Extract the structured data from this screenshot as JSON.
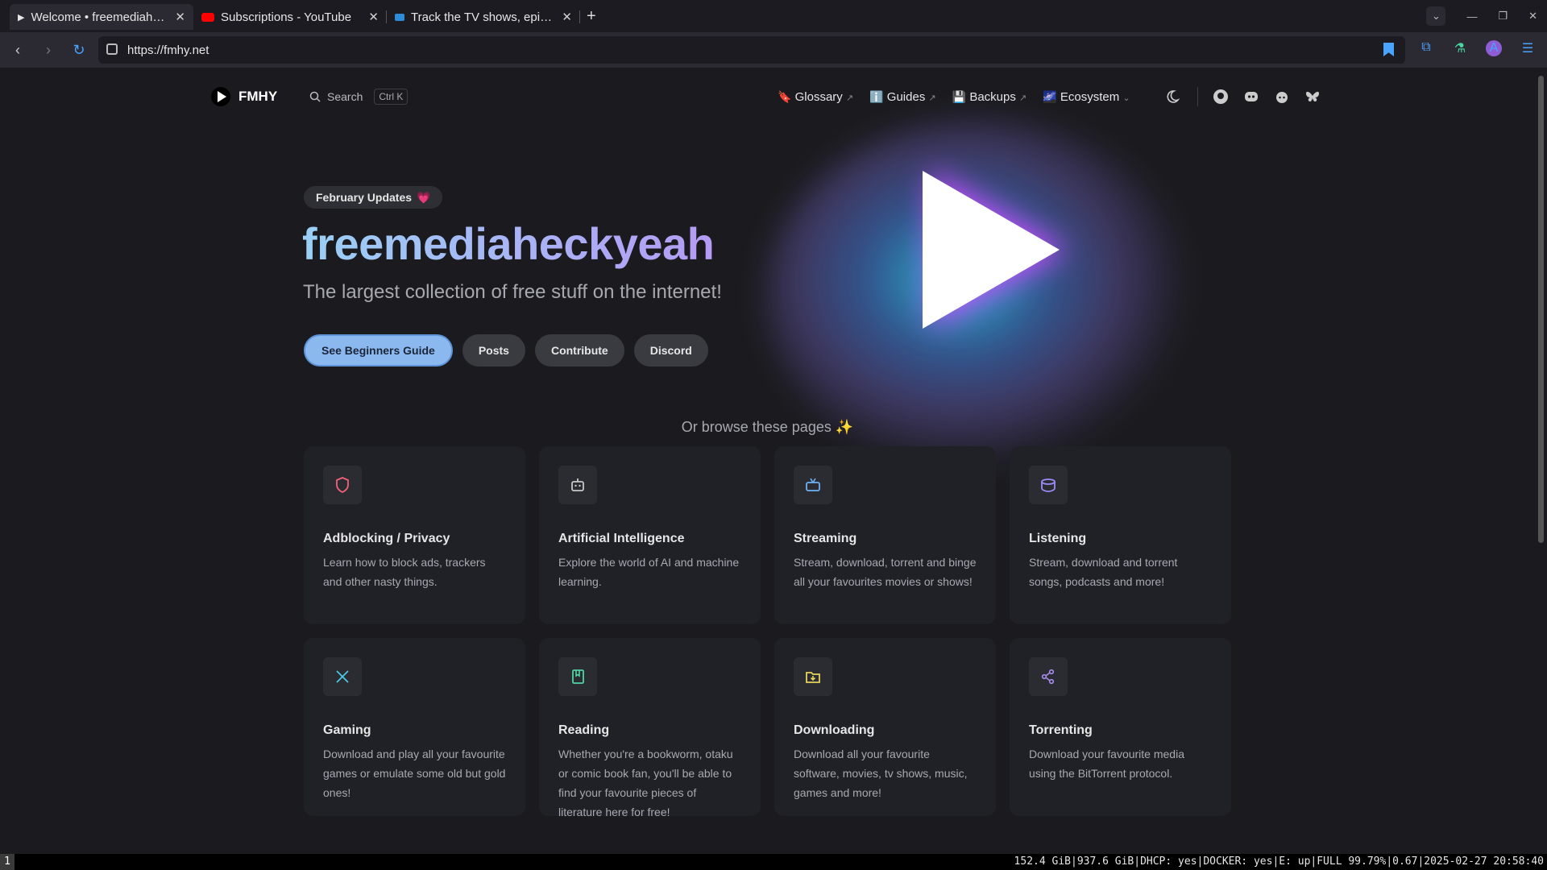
{
  "browser": {
    "tabs": [
      {
        "title": "Welcome • freemediaheckyeah",
        "icon": "play-favicon"
      },
      {
        "title": "Subscriptions - YouTube",
        "icon": "youtube-favicon"
      },
      {
        "title": "Track the TV shows, episodes",
        "icon": "tv-favicon"
      }
    ],
    "new_tab": "+",
    "url": "https://fmhy.net",
    "profile_initial": "A",
    "accent": "#4aa3ff"
  },
  "site": {
    "logo_text": "FMHY",
    "search_label": "Search",
    "search_kbd": "Ctrl K",
    "nav": [
      {
        "emoji": "🔖",
        "label": "Glossary",
        "arrow": "↗"
      },
      {
        "emoji": "ℹ️",
        "label": "Guides",
        "arrow": "↗"
      },
      {
        "emoji": "💾",
        "label": "Backups",
        "arrow": "↗"
      },
      {
        "emoji": "🌌",
        "label": "Ecosystem",
        "arrow": "⌄"
      }
    ],
    "badge": "February Updates",
    "badge_emoji": "💗",
    "title": "freemediaheckyeah",
    "tagline": "The largest collection of free stuff on the internet!",
    "buttons": [
      "See Beginners Guide",
      "Posts",
      "Contribute",
      "Discord"
    ],
    "browse_text": "Or browse these pages ✨",
    "cards": [
      {
        "title": "Adblocking / Privacy",
        "desc": "Learn how to block ads, trackers and other nasty things.",
        "icon": "shield-icon",
        "color": "#f0617a"
      },
      {
        "title": "Artificial Intelligence",
        "desc": "Explore the world of AI and machine learning.",
        "icon": "robot-icon",
        "color": "#c8c8c8"
      },
      {
        "title": "Streaming",
        "desc": "Stream, download, torrent and binge all your favourites movies or shows!",
        "icon": "tv-icon",
        "color": "#6cb2f5"
      },
      {
        "title": "Listening",
        "desc": "Stream, download and torrent songs, podcasts and more!",
        "icon": "drum-icon",
        "color": "#9b8cf5"
      },
      {
        "title": "Gaming",
        "desc": "Download and play all your favourite games or emulate some old but gold ones!",
        "icon": "swords-icon",
        "color": "#4cc7e6"
      },
      {
        "title": "Reading",
        "desc": "Whether you're a bookworm, otaku or comic book fan, you'll be able to find your favourite pieces of literature here for free!",
        "icon": "book-icon",
        "color": "#4dd6a3"
      },
      {
        "title": "Downloading",
        "desc": "Download all your favourite software, movies, tv shows, music, games and more!",
        "icon": "folder-download-icon",
        "color": "#e5d35c"
      },
      {
        "title": "Torrenting",
        "desc": "Download your favourite media using the BitTorrent protocol.",
        "icon": "share-nodes-icon",
        "color": "#a98bf0"
      }
    ]
  },
  "statusbar": {
    "workspace": "1",
    "info": "152.4 GiB|937.6 GiB|DHCP: yes|DOCKER: yes|E: up|FULL 99.79%|0.67|2025-02-27 20:58:40"
  }
}
